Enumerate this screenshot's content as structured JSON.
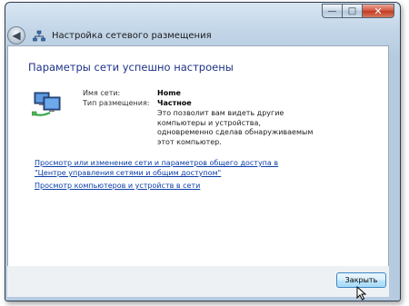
{
  "window": {
    "title": "Настройка сетевого размещения",
    "controls": {
      "minimize": "—",
      "maximize": "□",
      "close": "✕"
    },
    "back_glyph": "◀"
  },
  "main": {
    "heading": "Параметры сети успешно настроены",
    "network_name_label": "Имя сети:",
    "network_name_value": "Home",
    "location_type_label": "Тип размещения:",
    "location_type_value": "Частное",
    "description": "Это позволит вам видеть другие компьютеры и устройства, одновременно сделав обнаруживаемым этот компьютер.",
    "link_sharing_settings": "Просмотр или изменение сети и параметров общего доступа в \"Центре управления сетями и общим доступом\"",
    "link_view_computers": "Просмотр компьютеров и устройств в сети"
  },
  "footer": {
    "close_button": "Закрыть"
  },
  "icons": {
    "back": "back-arrow-icon",
    "network_small": "network-icon",
    "network_large": "network-computers-icon",
    "cursor": "mouse-pointer-icon"
  },
  "colors": {
    "heading": "#1e3287",
    "link": "#0b3ea8",
    "frame": "#c3d6e8",
    "button_border": "#3a87c6"
  }
}
